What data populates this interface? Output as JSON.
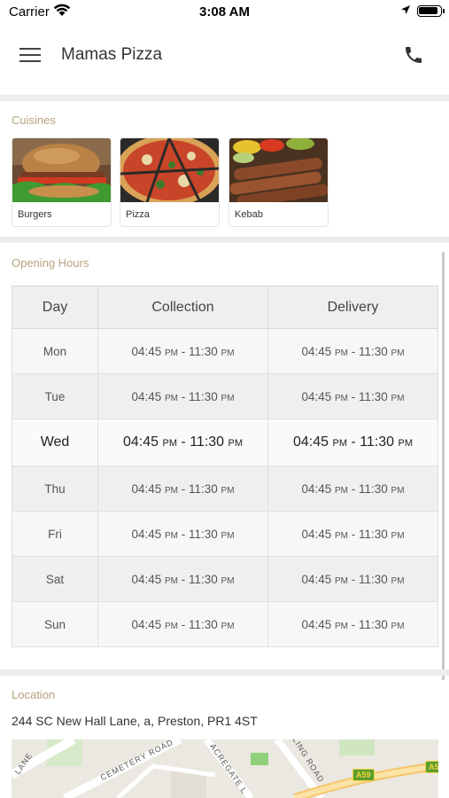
{
  "status_bar": {
    "carrier": "Carrier",
    "time": "3:08 AM"
  },
  "header": {
    "title": "Mamas Pizza"
  },
  "cuisines": {
    "label": "Cuisines",
    "items": [
      {
        "name": "Burgers"
      },
      {
        "name": "Pizza"
      },
      {
        "name": "Kebab"
      }
    ]
  },
  "opening_hours": {
    "label": "Opening Hours",
    "columns": [
      "Day",
      "Collection",
      "Delivery"
    ],
    "rows": [
      {
        "day": "Mon",
        "collection": {
          "open": "04:45",
          "open_period": "PM",
          "close": "11:30",
          "close_period": "PM"
        },
        "delivery": {
          "open": "04:45",
          "open_period": "PM",
          "close": "11:30",
          "close_period": "PM"
        }
      },
      {
        "day": "Tue",
        "collection": {
          "open": "04:45",
          "open_period": "PM",
          "close": "11:30",
          "close_period": "PM"
        },
        "delivery": {
          "open": "04:45",
          "open_period": "PM",
          "close": "11:30",
          "close_period": "PM"
        }
      },
      {
        "day": "Wed",
        "collection": {
          "open": "04:45",
          "open_period": "PM",
          "close": "11:30",
          "close_period": "PM"
        },
        "delivery": {
          "open": "04:45",
          "open_period": "PM",
          "close": "11:30",
          "close_period": "PM"
        }
      },
      {
        "day": "Thu",
        "collection": {
          "open": "04:45",
          "open_period": "PM",
          "close": "11:30",
          "close_period": "PM"
        },
        "delivery": {
          "open": "04:45",
          "open_period": "PM",
          "close": "11:30",
          "close_period": "PM"
        }
      },
      {
        "day": "Fri",
        "collection": {
          "open": "04:45",
          "open_period": "PM",
          "close": "11:30",
          "close_period": "PM"
        },
        "delivery": {
          "open": "04:45",
          "open_period": "PM",
          "close": "11:30",
          "close_period": "PM"
        }
      },
      {
        "day": "Sat",
        "collection": {
          "open": "04:45",
          "open_period": "PM",
          "close": "11:30",
          "close_period": "PM"
        },
        "delivery": {
          "open": "04:45",
          "open_period": "PM",
          "close": "11:30",
          "close_period": "PM"
        }
      },
      {
        "day": "Sun",
        "collection": {
          "open": "04:45",
          "open_period": "PM",
          "close": "11:30",
          "close_period": "PM"
        },
        "delivery": {
          "open": "04:45",
          "open_period": "PM",
          "close": "11:30",
          "close_period": "PM"
        }
      }
    ]
  },
  "location": {
    "label": "Location",
    "address": "244 SC New Hall Lane, a, Preston, PR1 4ST",
    "map_labels": [
      "LANE",
      "CEMETERY ROAD",
      "ACREGATE L",
      "LING ROAD",
      "A59",
      "A5"
    ]
  },
  "colors": {
    "section_label": "#b5a47e",
    "separator": "#ececec",
    "road_badge": "#5a9e2f"
  }
}
